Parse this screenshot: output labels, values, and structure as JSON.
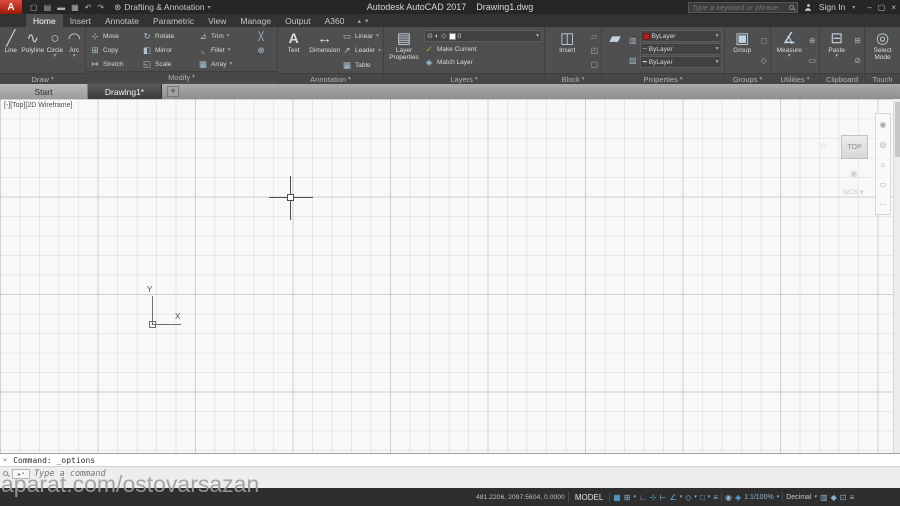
{
  "titlebar": {
    "logo_letter": "A",
    "workspace": "Drafting & Annotation",
    "doc_title": "Autodesk AutoCAD 2017    Drawing1.dwg",
    "search_placeholder": "Type a keyword or phrase",
    "sign_in": "Sign In",
    "min": "–",
    "max": "▢",
    "close": "×"
  },
  "tabs": {
    "items": [
      "Home",
      "Insert",
      "Annotate",
      "Parametric",
      "View",
      "Manage",
      "Output",
      "A360"
    ]
  },
  "draw": {
    "label": "Draw",
    "line": "Line",
    "polyline": "Polyline",
    "circle": "Circle",
    "arc": "Arc"
  },
  "modify": {
    "label": "Modify",
    "move": "Move",
    "rotate": "Rotate",
    "trim": "Trim",
    "copy": "Copy",
    "mirror": "Mirror",
    "fillet": "Fillet",
    "stretch": "Stretch",
    "scale": "Scale",
    "array": "Array"
  },
  "annotation": {
    "label": "Annotation",
    "text": "Text",
    "dimension": "Dimension",
    "linear": "Linear",
    "leader": "Leader",
    "table": "Table"
  },
  "layers": {
    "label": "Layers",
    "layer_properties": "Layer Properties",
    "current_layer": "0",
    "make_current": "Make Current",
    "match_layer": "Match Layer"
  },
  "block": {
    "label": "Block",
    "insert": "Insert"
  },
  "properties": {
    "label": "Properties",
    "color": "ByLayer",
    "linetype": "ByLayer",
    "lineweight": "ByLayer"
  },
  "groups": {
    "label": "Groups",
    "group": "Group"
  },
  "utilities": {
    "label": "Utilities",
    "measure": "Measure"
  },
  "clipboard": {
    "label": "Clipboard",
    "paste": "Paste"
  },
  "touch": {
    "label": "Touch",
    "select_mode": "Select Mode"
  },
  "file_tabs": {
    "start": "Start",
    "drawing": "Drawing1*",
    "new_tab": "+"
  },
  "canvas": {
    "viewport_controls": "[-][Top][2D Wireframe]",
    "viewcube_face": "TOP",
    "wcs": "WCS",
    "ucs_x": "X",
    "ucs_y": "Y"
  },
  "command": {
    "history": "Command: _options",
    "prompt": "Type a command"
  },
  "watermark": "aparat.com/ostovarsazan",
  "status": {
    "coords": "481.2206, 2097.5604, 0.0000",
    "model": "MODEL",
    "scale": "1:1/100%",
    "units": "Decimal"
  },
  "glyphs": {
    "caret": "▾",
    "caret_up": "▴",
    "ws_icon": "⊛",
    "qat_new": "▢",
    "qat_open": "▤",
    "qat_save": "▬",
    "qat_plot": "▦",
    "qat_undo": "↶",
    "qat_redo": "↷",
    "line": "╱",
    "polyline": "∿",
    "circle": "○",
    "arc": "◠",
    "move": "⊹",
    "rotate": "↻",
    "trim": "⊿",
    "copy": "⊞",
    "mirror": "◧",
    "fillet": "◟",
    "stretch": "↦",
    "scale": "◱",
    "array": "▦",
    "erase": "╳",
    "explode": "⊗",
    "text": "A",
    "dimension": "↔",
    "linear": "▭",
    "leader": "↗",
    "table": "▦",
    "layer_props": "▤",
    "bulb": "⊙",
    "sun": "◐",
    "freeze": "◇",
    "check": "✓",
    "match_layer": "◈",
    "insert": "◫",
    "blk1": "▱",
    "blk2": "◰",
    "blk3": "▢",
    "match_props": "▰",
    "p1": "▥",
    "p2": "▨",
    "linetype": "┄",
    "lineweight": "━",
    "group": "▣",
    "grp1": "◻",
    "grp2": "◇",
    "measure": "∡",
    "ut1": "⊕",
    "ut2": "▭",
    "paste": "⊟",
    "cb1": "⊞",
    "cb2": "⊘",
    "select_mode": "◎",
    "home": "⌂",
    "vc_icon": "▣",
    "nav1": "◉",
    "nav2": "◎",
    "nav3": "⌂",
    "nav4": "▭",
    "nav5": "⋯",
    "close_x": "×",
    "prompt_arrow": "▸",
    "prompt_dash": "▪",
    "sb_grid": "▦",
    "sb_snap": "⊞",
    "sb_infer": "∟",
    "sb_dyn": "⊹",
    "sb_ortho": "⊢",
    "sb_polar": "∠",
    "sb_iso": "◇",
    "sb_osnap": "□",
    "sb_lwt": "≡",
    "sb_annovis": "◉",
    "sb_autoscale": "◈",
    "sb_qp": "▥",
    "sb_iso2": "◆",
    "sb_clean": "⊡",
    "sb_cust": "≡"
  }
}
